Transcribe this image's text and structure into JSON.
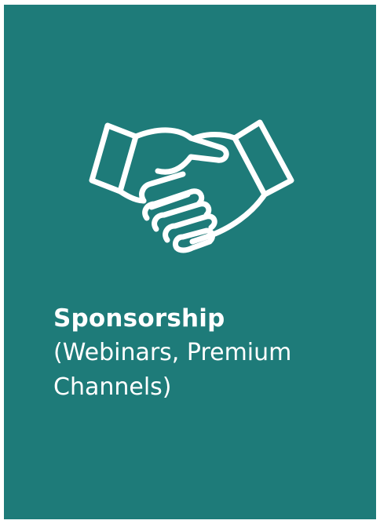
{
  "card": {
    "background_color": "#1e7b79",
    "icon": "handshake-icon",
    "title": "Sponsorship",
    "subtitle_line1": "(Webinars, Premium",
    "subtitle_line2": "Channels)"
  }
}
